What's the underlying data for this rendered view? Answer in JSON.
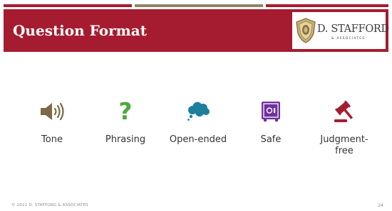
{
  "slide": {
    "title": "Question Format",
    "logo": {
      "name": "D. STAFFORD",
      "tagline": "& ASSOCIATES"
    },
    "items": [
      {
        "label": "Tone",
        "icon": "speaker-icon",
        "color": "#7b6a45"
      },
      {
        "label": "Phrasing",
        "icon": "question-mark-icon",
        "color": "#4caa3a"
      },
      {
        "label": "Open-ended",
        "icon": "thought-bubble-icon",
        "color": "#1c7f9c"
      },
      {
        "label": "Safe",
        "icon": "safe-icon",
        "color": "#7030a0"
      },
      {
        "label": "Judgment-free",
        "icon": "gavel-icon",
        "color": "#a51c30"
      }
    ],
    "copyright": "© 2021 D. STAFFORD & ASSOCIATES",
    "page_number": "24"
  },
  "colors": {
    "brand": "#a51c30",
    "accent": "#8c8464"
  }
}
